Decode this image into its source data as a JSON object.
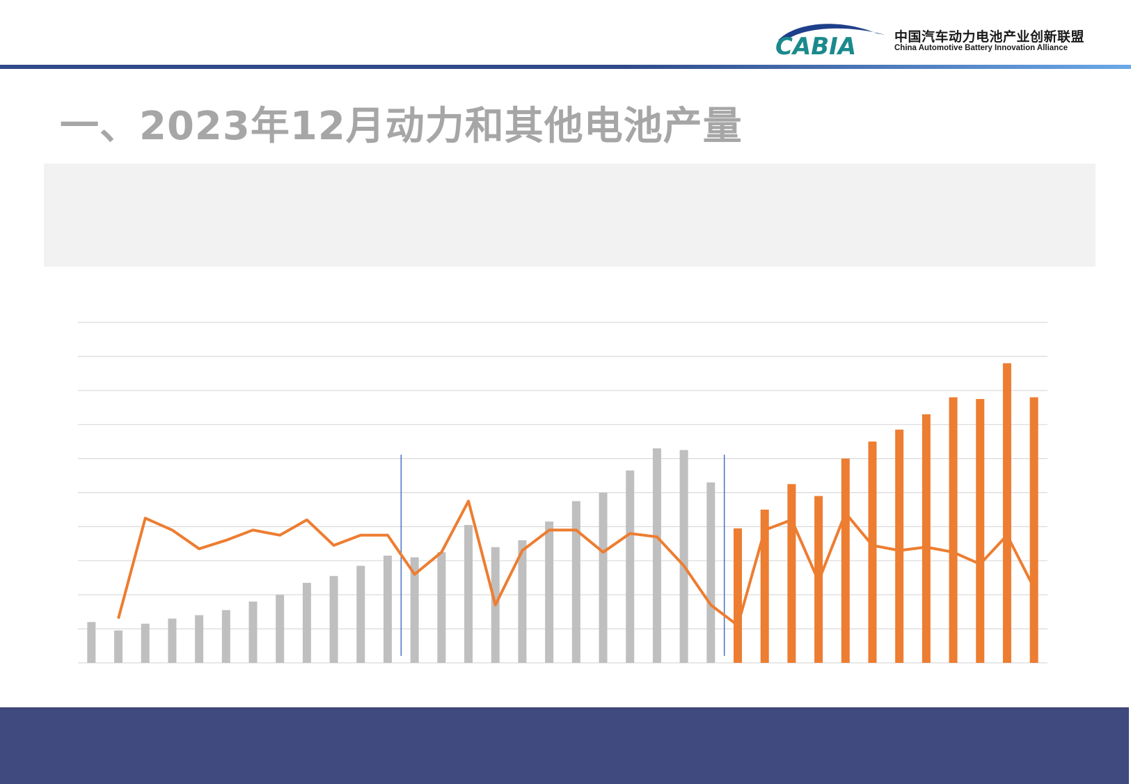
{
  "header": {
    "logo_text": "CABIA",
    "org_name_cn": "中国汽车动力电池产业创新联盟",
    "org_name_en": "China Automotive Battery Innovation Alliance"
  },
  "title": "一、2023年12月动力和其他电池产量",
  "colors": {
    "bar_gray": "#bfbfbf",
    "bar_orange": "#ed7d31",
    "line_orange": "#ed7d31",
    "divider_blue": "#4472c4",
    "footer_navy": "#404a7e",
    "logo_teal": "#1b8a8c",
    "logo_navy": "#1f3f8a"
  },
  "chart_data": {
    "type": "bar",
    "categories": [],
    "ylim": [
      0,
      100
    ],
    "gridlines": 10,
    "series": [
      {
        "values": [
          12,
          9.5,
          11.5,
          13,
          14,
          15.5,
          18,
          20,
          23.5,
          25.5,
          28.5,
          31.5,
          31,
          32.5,
          40.5,
          34,
          36,
          41.5,
          47.5,
          50,
          56.5,
          63,
          62.5,
          53,
          39.5,
          45,
          52.5,
          49,
          60,
          65,
          68.5,
          73,
          78,
          77.5,
          88,
          78
        ],
        "colors": [
          "gray",
          "gray",
          "gray",
          "gray",
          "gray",
          "gray",
          "gray",
          "gray",
          "gray",
          "gray",
          "gray",
          "gray",
          "gray",
          "gray",
          "gray",
          "gray",
          "gray",
          "gray",
          "gray",
          "gray",
          "gray",
          "gray",
          "gray",
          "gray",
          "orange",
          "orange",
          "orange",
          "orange",
          "orange",
          "orange",
          "orange",
          "orange",
          "orange",
          "orange",
          "orange",
          "orange"
        ]
      },
      {
        "type": "line",
        "values": [
          13,
          42.5,
          39,
          33.5,
          36,
          39,
          37.5,
          42,
          34.5,
          37.5,
          37.5,
          26,
          32.5,
          47.5,
          17,
          33,
          39,
          39,
          32.5,
          38,
          37,
          28.5,
          17,
          11,
          39,
          42,
          24,
          44,
          34.5,
          33,
          34,
          32.5,
          29,
          37.5,
          22
        ]
      }
    ],
    "dividers_after_index": [
      11,
      23
    ],
    "grid": true
  }
}
